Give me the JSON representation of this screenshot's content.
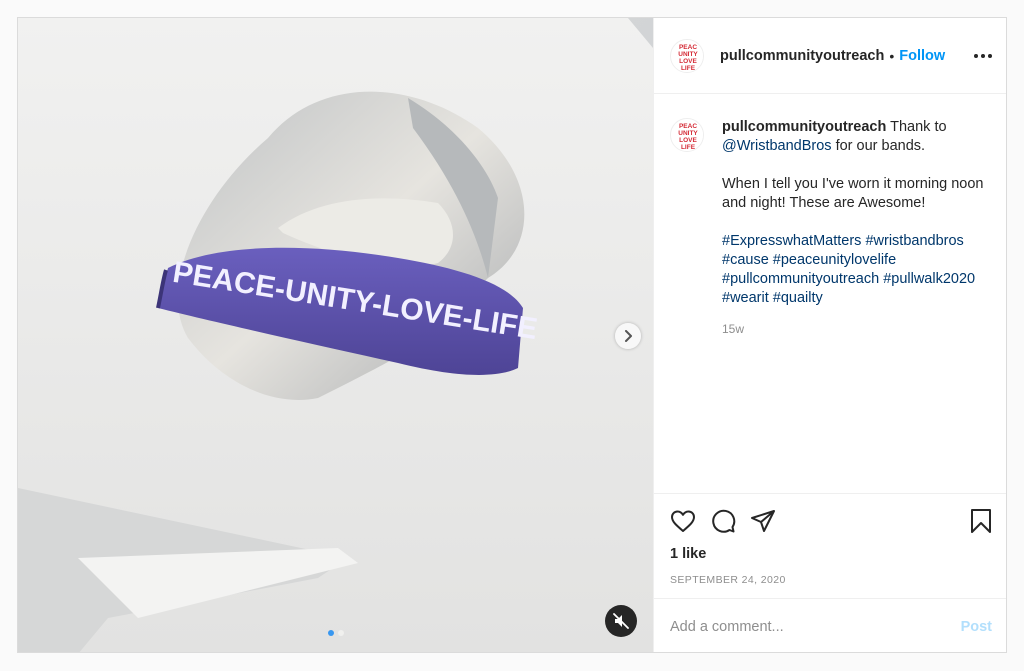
{
  "post": {
    "author": {
      "username": "pullcommunityoutreach",
      "avatar_icon": "peace-unity-love-life-logo"
    },
    "header": {
      "separator": "•",
      "follow_label": "Follow",
      "more_icon": "more-options-icon"
    },
    "media": {
      "wristband_text": "PEACE-UNITY-LOVE-LIFE",
      "wristband_color": "#5b4fa8",
      "carousel": {
        "current": 1,
        "total": 2
      },
      "next_icon": "chevron-right-icon",
      "mute_icon": "speaker-muted-icon"
    },
    "caption": {
      "username": "pullcommunityoutreach",
      "text_start": " Thank to ",
      "mention": "@WristbandBros",
      "text_end": " for our bands.",
      "paragraph2": "When I tell you I've worn it morning noon and night! These are Awesome!",
      "hashtags": [
        "#ExpresswhatMatters",
        "#wristbandbros",
        "#cause",
        "#peaceunitylovelife",
        "#pullcommunityoutreach",
        "#pullwalk2020",
        "#wearit",
        "#quailty"
      ],
      "time_ago": "15w"
    },
    "actions": {
      "icons": [
        "heart-icon",
        "comment-icon",
        "share-icon",
        "bookmark-icon"
      ],
      "likes": "1 like",
      "date": "SEPTEMBER 24, 2020"
    },
    "comment": {
      "placeholder": "Add a comment...",
      "post_label": "Post"
    },
    "colors": {
      "accent": "#0095f6",
      "link": "#00376b",
      "muted_text": "#8e8e8e",
      "disabled_post": "#b2dffc"
    }
  }
}
